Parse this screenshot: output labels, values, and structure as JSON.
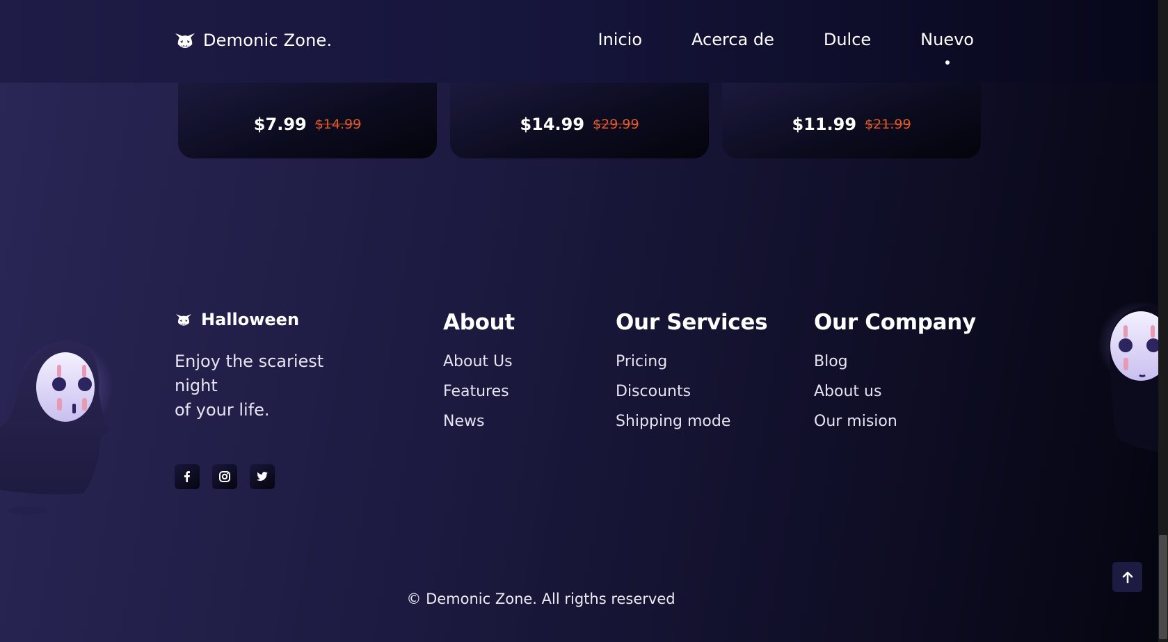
{
  "header": {
    "logo_text": "Demonic Zone.",
    "nav": [
      {
        "label": "Inicio"
      },
      {
        "label": "Acerca de"
      },
      {
        "label": "Dulce"
      },
      {
        "label": "Nuevo",
        "active": true
      }
    ]
  },
  "products": [
    {
      "price": "$7.99",
      "old_price": "$14.99"
    },
    {
      "price": "$14.99",
      "old_price": "$29.99"
    },
    {
      "price": "$11.99",
      "old_price": "$21.99"
    }
  ],
  "footer": {
    "brand": "Halloween",
    "tagline_lines": [
      "Enjoy the scariest",
      "night",
      "of your life."
    ],
    "socials": [
      "facebook-icon",
      "instagram-icon",
      "twitter-icon"
    ],
    "columns": [
      {
        "title": "About",
        "links": [
          "About Us",
          "Features",
          "News"
        ]
      },
      {
        "title": "Our Services",
        "links": [
          "Pricing",
          "Discounts",
          "Shipping mode"
        ]
      },
      {
        "title": "Our Company",
        "links": [
          "Blog",
          "About us",
          "Our mision"
        ]
      }
    ],
    "copyright": "© Demonic Zone. All rigths reserved"
  },
  "colors": {
    "accent_old_price": "#e2592c",
    "background_dark": "#050510",
    "background_light": "#2a2656"
  }
}
